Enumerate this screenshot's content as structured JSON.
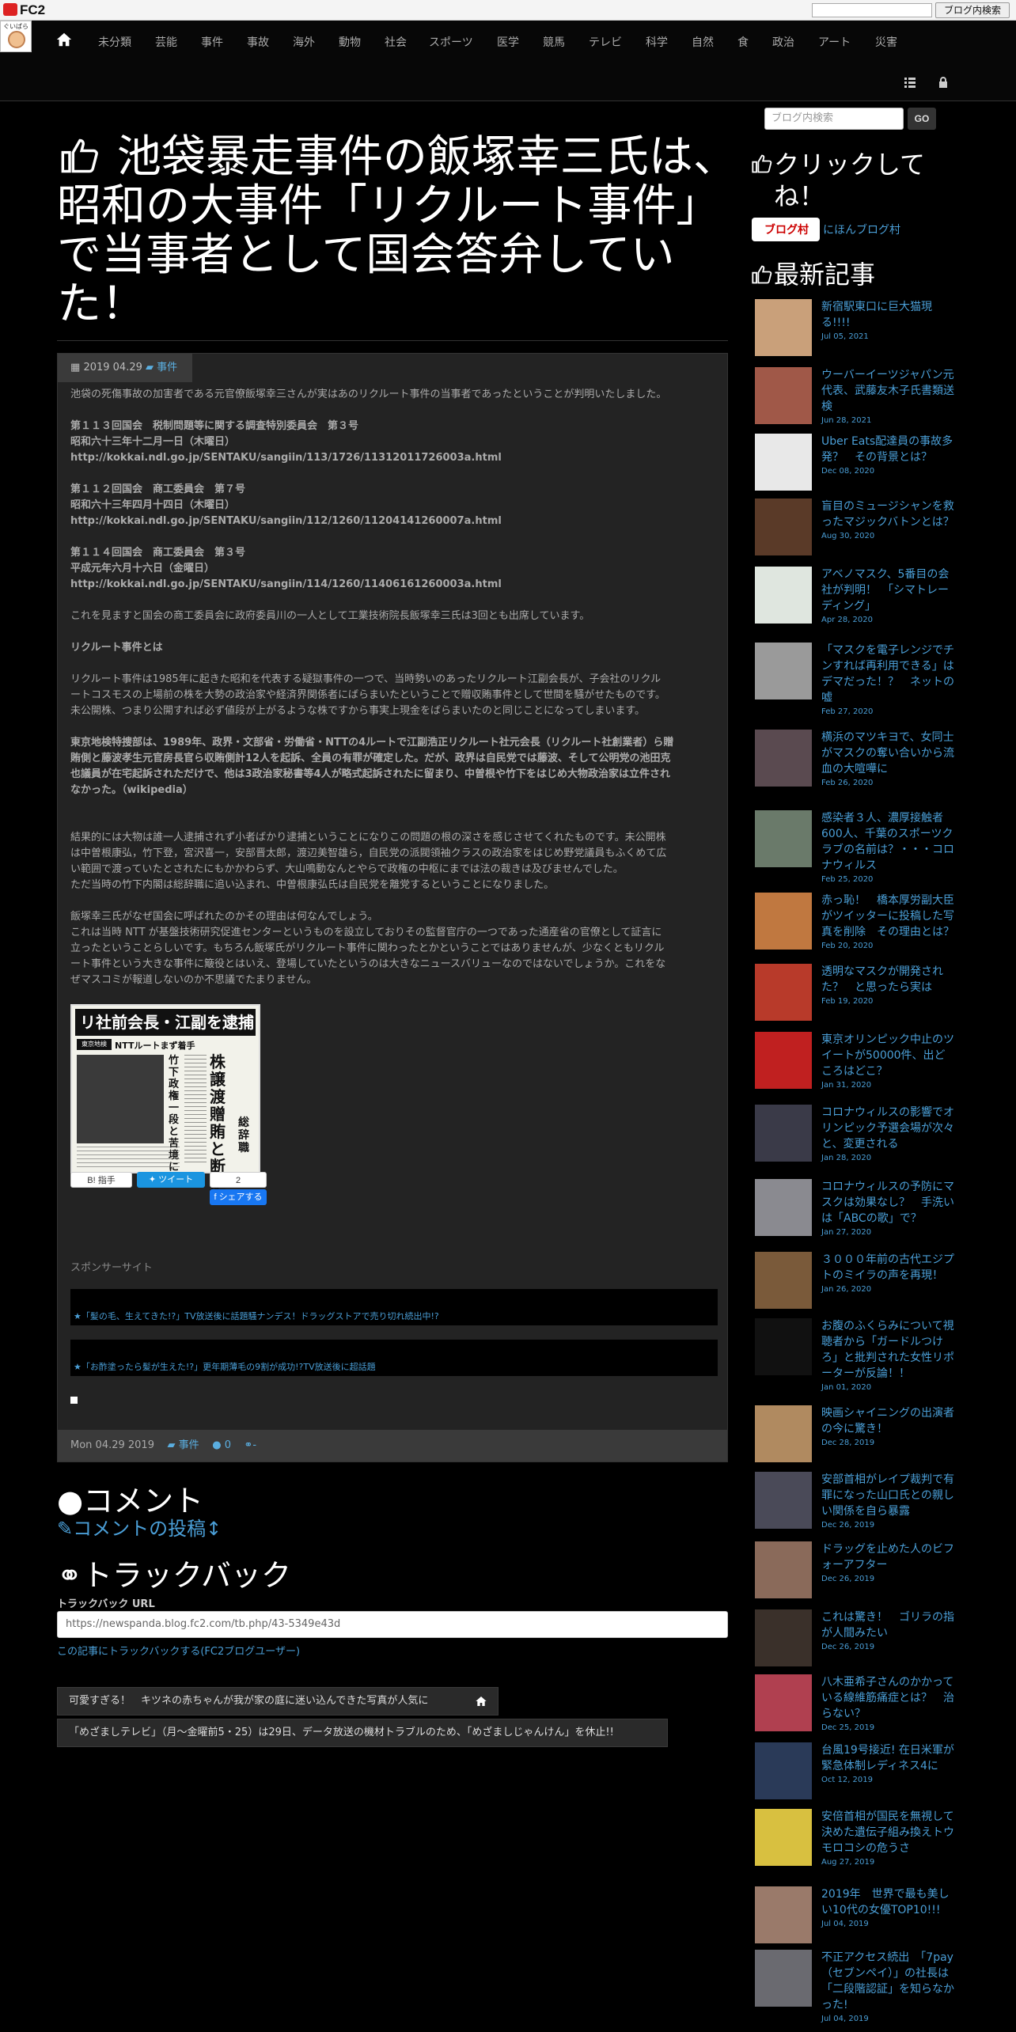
{
  "fc2bar": {
    "logo": "FC2",
    "search_button": "ブログ内検索"
  },
  "nav": {
    "logo_text": "ぐいぱら",
    "items": [
      "未分類",
      "芸能",
      "事件",
      "事故",
      "海外",
      "動物",
      "社会",
      "スポーツ",
      "医学",
      "競馬",
      "テレビ",
      "科学",
      "自然",
      "食",
      "政治",
      "アート",
      "災害"
    ]
  },
  "sidebar": {
    "search_placeholder": "ブログ内検索",
    "go_label": "GO",
    "click_heading": "クリックしてね！",
    "banner_text": "ブログ村",
    "banner_link": "にほんブログ村",
    "recent_heading": "最新記事",
    "recent": [
      {
        "title": "新宿駅東口に巨大猫現る!!!!",
        "date": "Jul 05, 2021",
        "color": "#c9a07a"
      },
      {
        "title": "ウーバーイーツジャパン元代表、武藤友木子氏書類送検",
        "date": "Jun 28, 2021",
        "color": "#a05848"
      },
      {
        "title": "Uber Eats配達員の事故多発？　その背景とは？",
        "date": "Dec 08, 2020",
        "color": "#e8e8e8"
      },
      {
        "title": "盲目のミュージシャンを救ったマジックバトンとは？",
        "date": "Aug 30, 2020",
        "color": "#5a3a28"
      },
      {
        "title": "アベノマスク、5番目の会社が判明！　「シマトレーディング」",
        "date": "Apr 28, 2020",
        "color": "#dfe6df"
      },
      {
        "title": "「マスクを電子レンジでチンすれば再利用できる」はデマだった！？　ネットの嘘",
        "date": "Feb 27, 2020",
        "color": "#9a9a9a"
      },
      {
        "title": "横浜のマツキヨで、女同士がマスクの奪い合いから流血の大喧嘩に",
        "date": "Feb 26, 2020",
        "color": "#5a4a50"
      },
      {
        "title": "感染者３人、濃厚接触者600人、千葉のスポーツクラブの名前は？・・・コロナウィルス",
        "date": "Feb 25, 2020",
        "color": "#6a7a6a"
      },
      {
        "title": "赤っ恥！　橋本厚労副大臣がツイッターに投稿した写真を削除　その理由とは？",
        "date": "Feb 20, 2020",
        "color": "#c07840"
      },
      {
        "title": "透明なマスクが開発された？　と思ったら実は",
        "date": "Feb 19, 2020",
        "color": "#b83a2a"
      },
      {
        "title": "東京オリンピック中止のツイートが50000件、出どころはどこ？",
        "date": "Jan 31, 2020",
        "color": "#c02020"
      },
      {
        "title": "コロナウィルスの影響でオリンピック予選会場が次々と、変更される",
        "date": "Jan 28, 2020",
        "color": "#3a3a48"
      },
      {
        "title": "コロナウィルスの予防にマスクは効果なし？　手洗いは「ABCの歌」で？",
        "date": "Jan 27, 2020",
        "color": "#8a8a90"
      },
      {
        "title": "３０００年前の古代エジプトのミイラの声を再現！",
        "date": "Jan 26, 2020",
        "color": "#7a5a3a"
      },
      {
        "title": "お腹のふくらみについて視聴者から「ガードルつけろ」と批判された女性リポーターが反論！！",
        "date": "Jan 01, 2020",
        "color": "#111111"
      },
      {
        "title": "映画シャイニングの出演者の今に驚き！",
        "date": "Dec 28, 2019",
        "color": "#b08a60"
      },
      {
        "title": "安部首相がレイプ裁判で有罪になった山口氏との親しい関係を自ら暴露",
        "date": "Dec 26, 2019",
        "color": "#4a4a58"
      },
      {
        "title": "ドラッグを止めた人のビフォーアフター",
        "date": "Dec 26, 2019",
        "color": "#8a6a5a"
      },
      {
        "title": "これは驚き！　ゴリラの指が人間みたい",
        "date": "Dec 26, 2019",
        "color": "#3a302a"
      },
      {
        "title": "八木亜希子さんのかかっている線維筋痛症とは？　治らない？",
        "date": "Dec 25, 2019",
        "color": "#b04050"
      },
      {
        "title": "台風19号接近! 在日米軍が緊急体制レディネス4に",
        "date": "Oct 12, 2019",
        "color": "#2a3a58"
      },
      {
        "title": "安倍首相が国民を無視して決めた遺伝子組み換えトウモロコシの危うさ",
        "date": "Aug 27, 2019",
        "color": "#d8c040"
      },
      {
        "title": "2019年　世界で最も美しい10代の女優TOP10!!!",
        "date": "Jul 04, 2019",
        "color": "#9a7a6a"
      },
      {
        "title": "不正アクセス続出　「7pay（セブンペイ）」の社長は「二段階認証」を知らなかった!",
        "date": "Jul 04, 2019",
        "color": "#6a6a70"
      }
    ]
  },
  "article": {
    "title": "池袋暴走事件の飯塚幸三氏は、昭和の大事件「リクルート事件」で当事者として国会答弁していた！",
    "date": "2019 04.29",
    "category": "事件",
    "intro": "池袋の死傷事故の加害者である元官僚飯塚幸三さんが実はあのリクルート事件の当事者であったということが判明いたしました。",
    "ref1": [
      "第１１３回国会　税制問題等に関する調査特別委員会　第３号",
      "昭和六十三年十二月一日（木曜日）",
      "http://kokkai.ndl.go.jp/SENTAKU/sangiin/113/1726/11312011726003a.html"
    ],
    "ref2": [
      "第１１２回国会　商工委員会　第７号",
      "昭和六十三年四月十四日（木曜日）",
      "http://kokkai.ndl.go.jp/SENTAKU/sangiin/112/1260/11204141260007a.html"
    ],
    "ref3": [
      "第１１４回国会　商工委員会　第３号",
      "平成元年六月十六日（金曜日）",
      "http://kokkai.ndl.go.jp/SENTAKU/sangiin/114/1260/11406161260003a.html"
    ],
    "p2": "これを見ますと国会の商工委員会に政府委員川の一人として工業技術院長飯塚幸三氏は3回とも出席しています。",
    "subhead": "リクルート事件とは",
    "p3": [
      "リクルート事件は1985年に起きた昭和を代表する疑獄事件の一つで、当時勢いのあったリクルート江副会長が、子会社のリクル",
      "ートコスモスの上場前の株を大勢の政治家や経済界関係者にばらまいたということで贈収賄事件として世間を騒がせたものです。",
      "未公開株、つまり公開すれば必ず値段が上がるような株ですから事実上現金をばらまいたのと同じことになってしまいます。"
    ],
    "p4": [
      "東京地検特捜部は、1989年、政界・文部省・労働省・NTTの4ルートで江副浩正リクルート社元会長（リクルート社創業者）ら贈",
      "賄側と藤波孝生元官房長官ら収賄側計12人を起訴、全員の有罪が確定した。だが、政界は自民党では藤波、そして公明党の池田克",
      "也議員が在宅起訴されただけで、他は3政治家秘書等4人が略式起訴されたに留まり、中曽根や竹下をはじめ大物政治家は立件され",
      "なかった。（wikipedia）"
    ],
    "p5": [
      "結果的には大物は誰一人逮捕されず小者ばかり逮捕ということになりこの問題の根の深さを感じさせてくれたものです。未公開株",
      "は中曽根康弘，竹下登，宮沢喜一，安部晋太郎，渡辺美智雄ら，自民党の派閥領袖クラスの政治家をはじめ野党議員もふくめて広",
      "い範囲で渡っていたとされたにもかかわらず、大山鳴動なんとやらで政権の中枢にまでは法の裁きは及びませんでした。",
      "ただ当時の竹下内閣は総辞職に追い込まれ、中曽根康弘氏は自民党を離党するということになりました。"
    ],
    "p6": [
      "飯塚幸三氏がなぜ国会に呼ばれたのかその理由は何なんでしょう。",
      "これは当時 NTT が基盤技術研究促進センターというものを設立しておりその監督官庁の一つであった通産省の官僚として証言に",
      "立ったということらしいです。もちろん飯塚氏がリクルート事件に関わったとかということではありませんが、少なくともリクル",
      "ート事件という大きな事件に簸役とはいえ、登場していたというのは大きなニュースバリューなのではないでしょうか。これをな",
      "ぜマスコミが報道しないのか不思議でたまりません。"
    ],
    "newspaper": {
      "headline": "リ社前会長・江副を逮捕",
      "badge": "東京地検",
      "sub": "NTTルートまず着手",
      "side": "株譲渡 贈賄と断定",
      "caption": "竹下政権 一段と苦境に",
      "ref": "総辞職"
    },
    "share": {
      "hatena": "B! 指手",
      "tweet": "ツイート",
      "count": "2",
      "fb": "シェアする"
    },
    "sponsor_label": "スポンサーサイト",
    "ad1": "★「髪の毛、生えてきた!?」TV放送後に話題騒ナンデス！ドラッグストアで売り切れ続出中!?",
    "ad2": "★「お酢塗ったら髪が生えた!?」更年期薄毛の9割が成功!?TV放送後に超話題",
    "footer_date": "Mon 04.29 2019",
    "footer_cat": "事件",
    "footer_comments": "0",
    "footer_tb": "-"
  },
  "comments": {
    "heading": "コメント",
    "post_link": "コメントの投稿"
  },
  "trackback": {
    "heading": "トラックバック",
    "url_label": "トラックバック URL",
    "url": "https://newspanda.blog.fc2.com/tb.php/43-5349e43d",
    "fc2_link": "この記事にトラックバックする(FC2ブログユーザー)"
  },
  "pager": {
    "prev": "可愛すぎる！　キツネの赤ちゃんが我が家の庭に迷い込んできた写真が人気に",
    "next": "「めざましテレビ」（月～金曜前5・25）は29日、データ放送の機材トラブルのため、「めざましじゃんけん」を休止!!"
  }
}
